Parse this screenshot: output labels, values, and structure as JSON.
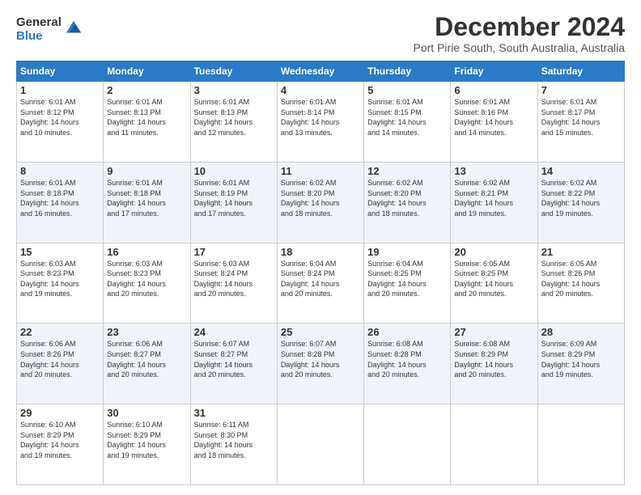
{
  "logo": {
    "general": "General",
    "blue": "Blue"
  },
  "title": "December 2024",
  "subtitle": "Port Pirie South, South Australia, Australia",
  "headers": [
    "Sunday",
    "Monday",
    "Tuesday",
    "Wednesday",
    "Thursday",
    "Friday",
    "Saturday"
  ],
  "weeks": [
    [
      {
        "day": "1",
        "info": "Sunrise: 6:01 AM\nSunset: 8:12 PM\nDaylight: 14 hours\nand 10 minutes."
      },
      {
        "day": "2",
        "info": "Sunrise: 6:01 AM\nSunset: 8:13 PM\nDaylight: 14 hours\nand 11 minutes."
      },
      {
        "day": "3",
        "info": "Sunrise: 6:01 AM\nSunset: 8:13 PM\nDaylight: 14 hours\nand 12 minutes."
      },
      {
        "day": "4",
        "info": "Sunrise: 6:01 AM\nSunset: 8:14 PM\nDaylight: 14 hours\nand 13 minutes."
      },
      {
        "day": "5",
        "info": "Sunrise: 6:01 AM\nSunset: 8:15 PM\nDaylight: 14 hours\nand 14 minutes."
      },
      {
        "day": "6",
        "info": "Sunrise: 6:01 AM\nSunset: 8:16 PM\nDaylight: 14 hours\nand 14 minutes."
      },
      {
        "day": "7",
        "info": "Sunrise: 6:01 AM\nSunset: 8:17 PM\nDaylight: 14 hours\nand 15 minutes."
      }
    ],
    [
      {
        "day": "8",
        "info": "Sunrise: 6:01 AM\nSunset: 8:18 PM\nDaylight: 14 hours\nand 16 minutes."
      },
      {
        "day": "9",
        "info": "Sunrise: 6:01 AM\nSunset: 8:18 PM\nDaylight: 14 hours\nand 17 minutes."
      },
      {
        "day": "10",
        "info": "Sunrise: 6:01 AM\nSunset: 8:19 PM\nDaylight: 14 hours\nand 17 minutes."
      },
      {
        "day": "11",
        "info": "Sunrise: 6:02 AM\nSunset: 8:20 PM\nDaylight: 14 hours\nand 18 minutes."
      },
      {
        "day": "12",
        "info": "Sunrise: 6:02 AM\nSunset: 8:20 PM\nDaylight: 14 hours\nand 18 minutes."
      },
      {
        "day": "13",
        "info": "Sunrise: 6:02 AM\nSunset: 8:21 PM\nDaylight: 14 hours\nand 19 minutes."
      },
      {
        "day": "14",
        "info": "Sunrise: 6:02 AM\nSunset: 8:22 PM\nDaylight: 14 hours\nand 19 minutes."
      }
    ],
    [
      {
        "day": "15",
        "info": "Sunrise: 6:03 AM\nSunset: 8:23 PM\nDaylight: 14 hours\nand 19 minutes."
      },
      {
        "day": "16",
        "info": "Sunrise: 6:03 AM\nSunset: 8:23 PM\nDaylight: 14 hours\nand 20 minutes."
      },
      {
        "day": "17",
        "info": "Sunrise: 6:03 AM\nSunset: 8:24 PM\nDaylight: 14 hours\nand 20 minutes."
      },
      {
        "day": "18",
        "info": "Sunrise: 6:04 AM\nSunset: 8:24 PM\nDaylight: 14 hours\nand 20 minutes."
      },
      {
        "day": "19",
        "info": "Sunrise: 6:04 AM\nSunset: 8:25 PM\nDaylight: 14 hours\nand 20 minutes."
      },
      {
        "day": "20",
        "info": "Sunrise: 6:05 AM\nSunset: 8:25 PM\nDaylight: 14 hours\nand 20 minutes."
      },
      {
        "day": "21",
        "info": "Sunrise: 6:05 AM\nSunset: 8:26 PM\nDaylight: 14 hours\nand 20 minutes."
      }
    ],
    [
      {
        "day": "22",
        "info": "Sunrise: 6:06 AM\nSunset: 8:26 PM\nDaylight: 14 hours\nand 20 minutes."
      },
      {
        "day": "23",
        "info": "Sunrise: 6:06 AM\nSunset: 8:27 PM\nDaylight: 14 hours\nand 20 minutes."
      },
      {
        "day": "24",
        "info": "Sunrise: 6:07 AM\nSunset: 8:27 PM\nDaylight: 14 hours\nand 20 minutes."
      },
      {
        "day": "25",
        "info": "Sunrise: 6:07 AM\nSunset: 8:28 PM\nDaylight: 14 hours\nand 20 minutes."
      },
      {
        "day": "26",
        "info": "Sunrise: 6:08 AM\nSunset: 8:28 PM\nDaylight: 14 hours\nand 20 minutes."
      },
      {
        "day": "27",
        "info": "Sunrise: 6:08 AM\nSunset: 8:29 PM\nDaylight: 14 hours\nand 20 minutes."
      },
      {
        "day": "28",
        "info": "Sunrise: 6:09 AM\nSunset: 8:29 PM\nDaylight: 14 hours\nand 19 minutes."
      }
    ],
    [
      {
        "day": "29",
        "info": "Sunrise: 6:10 AM\nSunset: 8:29 PM\nDaylight: 14 hours\nand 19 minutes."
      },
      {
        "day": "30",
        "info": "Sunrise: 6:10 AM\nSunset: 8:29 PM\nDaylight: 14 hours\nand 19 minutes."
      },
      {
        "day": "31",
        "info": "Sunrise: 6:11 AM\nSunset: 8:30 PM\nDaylight: 14 hours\nand 18 minutes."
      },
      {
        "day": "",
        "info": ""
      },
      {
        "day": "",
        "info": ""
      },
      {
        "day": "",
        "info": ""
      },
      {
        "day": "",
        "info": ""
      }
    ]
  ]
}
